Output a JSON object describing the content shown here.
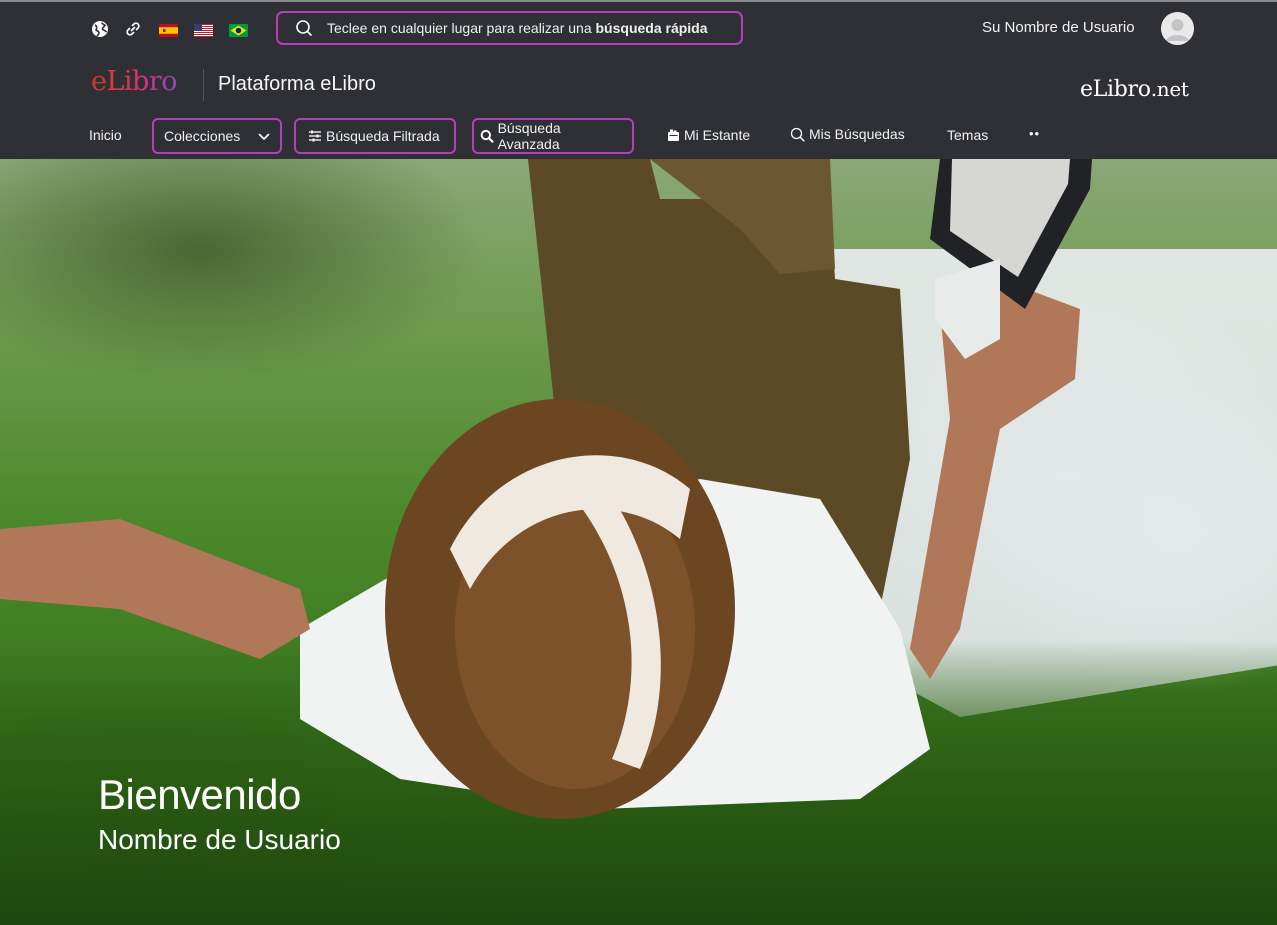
{
  "header": {
    "quick_search": {
      "text": "Teclee en cualquier lugar para realizar una ",
      "text_bold": "búsqueda rápida"
    },
    "username": "Su Nombre de Usuario",
    "logo_left": {
      "e": "e",
      "libro": "Libro"
    },
    "platform_title": "Plataforma eLibro",
    "logo_right": {
      "main": "eLibro",
      "suffix": ".net"
    },
    "icons": [
      "globe-icon",
      "link-icon",
      "flag-spain-icon",
      "flag-usa-icon",
      "flag-brazil-icon",
      "search-icon",
      "user-avatar-icon"
    ]
  },
  "nav": {
    "inicio": "Inicio",
    "colecciones": "Colecciones",
    "busqueda_filtrada": "Búsqueda Filtrada",
    "busqueda_avanzada": "Búsqueda Avanzada",
    "mi_estante": "Mi Estante",
    "mis_busquedas": "Mis Búsquedas",
    "temas": "Temas",
    "more": "••"
  },
  "hero": {
    "welcome": "Bienvenido",
    "name": "Nombre de Usuario"
  },
  "colors": {
    "header_bg": "#2f3035",
    "highlight_border": "#b93db6",
    "text": "#f1f1f1"
  }
}
